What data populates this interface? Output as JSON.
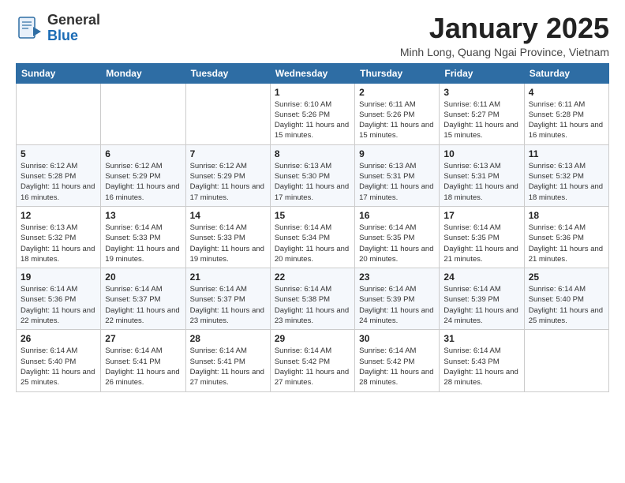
{
  "logo": {
    "general": "General",
    "blue": "Blue"
  },
  "title": {
    "month_year": "January 2025",
    "location": "Minh Long, Quang Ngai Province, Vietnam"
  },
  "days_of_week": [
    "Sunday",
    "Monday",
    "Tuesday",
    "Wednesday",
    "Thursday",
    "Friday",
    "Saturday"
  ],
  "weeks": [
    [
      {
        "day": "",
        "info": ""
      },
      {
        "day": "",
        "info": ""
      },
      {
        "day": "",
        "info": ""
      },
      {
        "day": "1",
        "info": "Sunrise: 6:10 AM\nSunset: 5:26 PM\nDaylight: 11 hours and 15 minutes."
      },
      {
        "day": "2",
        "info": "Sunrise: 6:11 AM\nSunset: 5:26 PM\nDaylight: 11 hours and 15 minutes."
      },
      {
        "day": "3",
        "info": "Sunrise: 6:11 AM\nSunset: 5:27 PM\nDaylight: 11 hours and 15 minutes."
      },
      {
        "day": "4",
        "info": "Sunrise: 6:11 AM\nSunset: 5:28 PM\nDaylight: 11 hours and 16 minutes."
      }
    ],
    [
      {
        "day": "5",
        "info": "Sunrise: 6:12 AM\nSunset: 5:28 PM\nDaylight: 11 hours and 16 minutes."
      },
      {
        "day": "6",
        "info": "Sunrise: 6:12 AM\nSunset: 5:29 PM\nDaylight: 11 hours and 16 minutes."
      },
      {
        "day": "7",
        "info": "Sunrise: 6:12 AM\nSunset: 5:29 PM\nDaylight: 11 hours and 17 minutes."
      },
      {
        "day": "8",
        "info": "Sunrise: 6:13 AM\nSunset: 5:30 PM\nDaylight: 11 hours and 17 minutes."
      },
      {
        "day": "9",
        "info": "Sunrise: 6:13 AM\nSunset: 5:31 PM\nDaylight: 11 hours and 17 minutes."
      },
      {
        "day": "10",
        "info": "Sunrise: 6:13 AM\nSunset: 5:31 PM\nDaylight: 11 hours and 18 minutes."
      },
      {
        "day": "11",
        "info": "Sunrise: 6:13 AM\nSunset: 5:32 PM\nDaylight: 11 hours and 18 minutes."
      }
    ],
    [
      {
        "day": "12",
        "info": "Sunrise: 6:13 AM\nSunset: 5:32 PM\nDaylight: 11 hours and 18 minutes."
      },
      {
        "day": "13",
        "info": "Sunrise: 6:14 AM\nSunset: 5:33 PM\nDaylight: 11 hours and 19 minutes."
      },
      {
        "day": "14",
        "info": "Sunrise: 6:14 AM\nSunset: 5:33 PM\nDaylight: 11 hours and 19 minutes."
      },
      {
        "day": "15",
        "info": "Sunrise: 6:14 AM\nSunset: 5:34 PM\nDaylight: 11 hours and 20 minutes."
      },
      {
        "day": "16",
        "info": "Sunrise: 6:14 AM\nSunset: 5:35 PM\nDaylight: 11 hours and 20 minutes."
      },
      {
        "day": "17",
        "info": "Sunrise: 6:14 AM\nSunset: 5:35 PM\nDaylight: 11 hours and 21 minutes."
      },
      {
        "day": "18",
        "info": "Sunrise: 6:14 AM\nSunset: 5:36 PM\nDaylight: 11 hours and 21 minutes."
      }
    ],
    [
      {
        "day": "19",
        "info": "Sunrise: 6:14 AM\nSunset: 5:36 PM\nDaylight: 11 hours and 22 minutes."
      },
      {
        "day": "20",
        "info": "Sunrise: 6:14 AM\nSunset: 5:37 PM\nDaylight: 11 hours and 22 minutes."
      },
      {
        "day": "21",
        "info": "Sunrise: 6:14 AM\nSunset: 5:37 PM\nDaylight: 11 hours and 23 minutes."
      },
      {
        "day": "22",
        "info": "Sunrise: 6:14 AM\nSunset: 5:38 PM\nDaylight: 11 hours and 23 minutes."
      },
      {
        "day": "23",
        "info": "Sunrise: 6:14 AM\nSunset: 5:39 PM\nDaylight: 11 hours and 24 minutes."
      },
      {
        "day": "24",
        "info": "Sunrise: 6:14 AM\nSunset: 5:39 PM\nDaylight: 11 hours and 24 minutes."
      },
      {
        "day": "25",
        "info": "Sunrise: 6:14 AM\nSunset: 5:40 PM\nDaylight: 11 hours and 25 minutes."
      }
    ],
    [
      {
        "day": "26",
        "info": "Sunrise: 6:14 AM\nSunset: 5:40 PM\nDaylight: 11 hours and 25 minutes."
      },
      {
        "day": "27",
        "info": "Sunrise: 6:14 AM\nSunset: 5:41 PM\nDaylight: 11 hours and 26 minutes."
      },
      {
        "day": "28",
        "info": "Sunrise: 6:14 AM\nSunset: 5:41 PM\nDaylight: 11 hours and 27 minutes."
      },
      {
        "day": "29",
        "info": "Sunrise: 6:14 AM\nSunset: 5:42 PM\nDaylight: 11 hours and 27 minutes."
      },
      {
        "day": "30",
        "info": "Sunrise: 6:14 AM\nSunset: 5:42 PM\nDaylight: 11 hours and 28 minutes."
      },
      {
        "day": "31",
        "info": "Sunrise: 6:14 AM\nSunset: 5:43 PM\nDaylight: 11 hours and 28 minutes."
      },
      {
        "day": "",
        "info": ""
      }
    ]
  ]
}
